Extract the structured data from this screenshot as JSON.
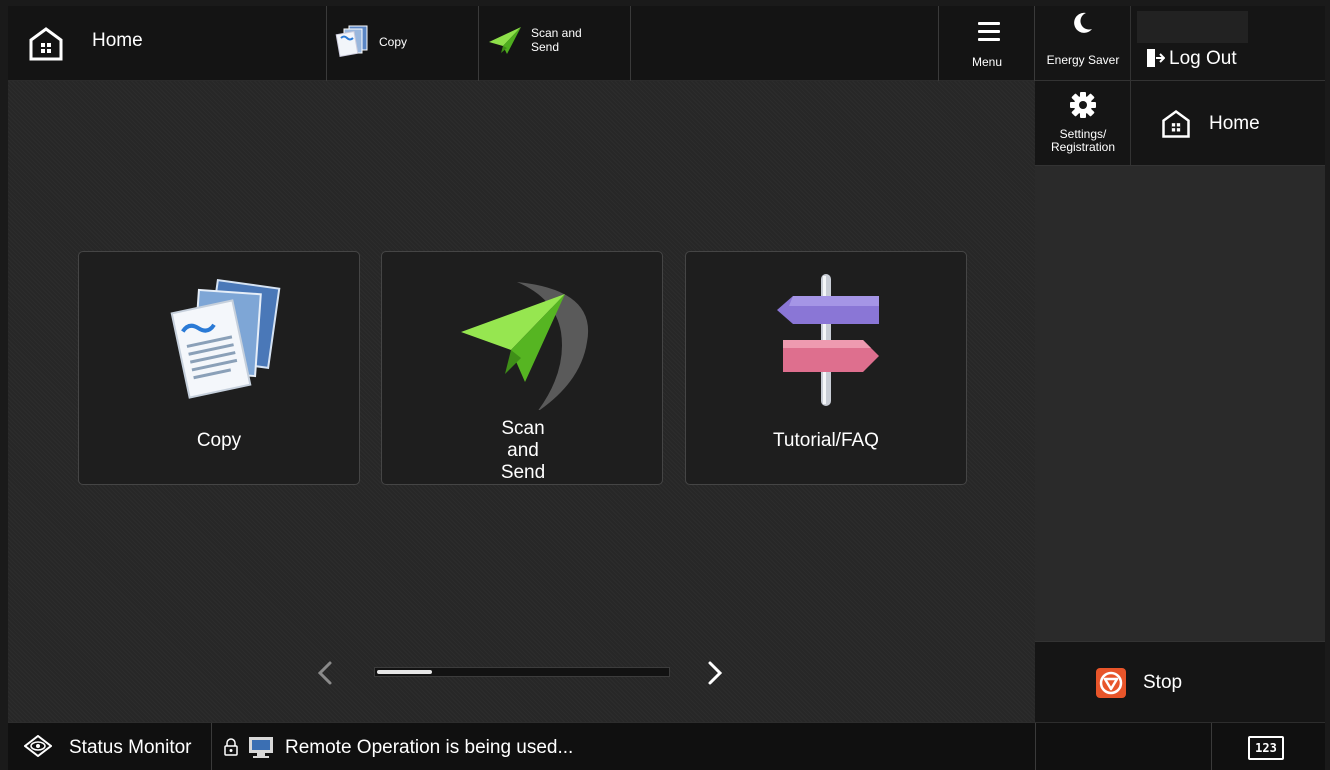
{
  "topbar": {
    "home_label": "Home",
    "copy_label": "Copy",
    "scan_label": "Scan and Send",
    "menu_label": "Menu"
  },
  "tiles": [
    {
      "label": "Copy",
      "icon": "copy-documents-icon"
    },
    {
      "label": "Scan and Send",
      "icon": "paper-plane-icon"
    },
    {
      "label": "Tutorial/FAQ",
      "icon": "signpost-icon"
    }
  ],
  "pager": {
    "page": 1,
    "position_fraction": 0.19
  },
  "rightpanel": {
    "energy_label": "Energy Saver",
    "logout_label": "Log Out",
    "settings_label_1": "Settings/",
    "settings_label_2": "Registration",
    "home_label": "Home",
    "stop_label": "Stop"
  },
  "statusbar": {
    "status_monitor_label": "Status Monitor",
    "message": "Remote Operation is being used...",
    "keyboard_label": "123"
  },
  "colors": {
    "stop_accent": "#e8552a",
    "plane_green": "#6fd02a",
    "sign_purple": "#8b7ad8",
    "sign_pink": "#e07a96"
  }
}
